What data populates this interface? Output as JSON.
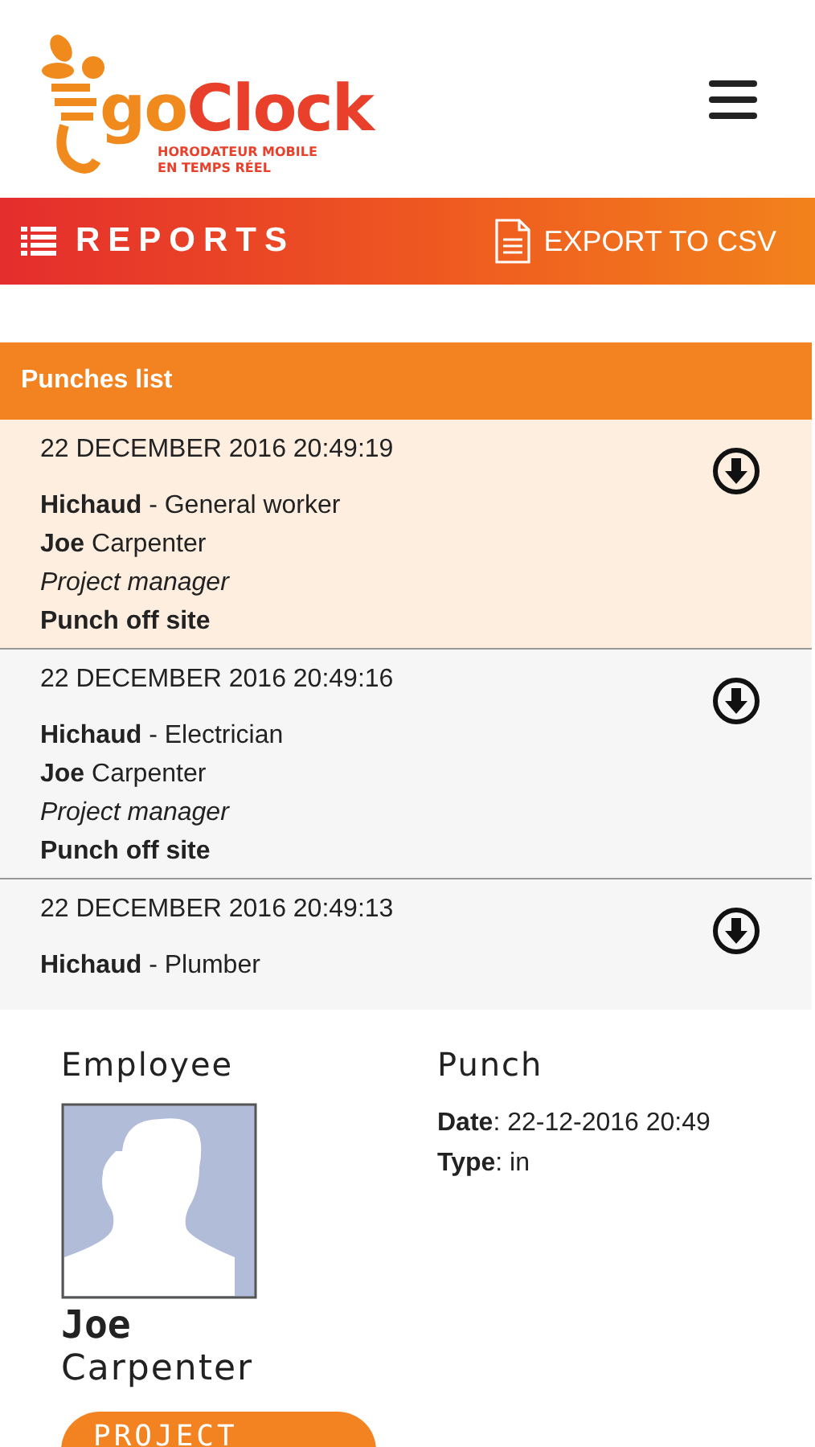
{
  "header": {
    "logo": {
      "prefix": "go",
      "name": "Clock",
      "tagline_1": "HORODATEUR MOBILE",
      "tagline_2": "EN TEMPS RÉEL"
    }
  },
  "toolbar": {
    "title": "REPORTS",
    "action": "EXPORT TO CSV"
  },
  "punches": {
    "title": "Punches list",
    "items": [
      {
        "timestamp": "22 DECEMBER 2016 20:49:19",
        "line_1": "**Hichaud** - General worker",
        "line_2": "**Joe** Carpenter",
        "role": "Project manager",
        "location": "Punch off site",
        "selected": true
      },
      {
        "timestamp": "22 DECEMBER 2016 20:49:16",
        "line_1": "**Hichaud** - Electrician",
        "line_2": "**Joe** Carpenter",
        "role": "Project manager",
        "location": "Punch off site",
        "selected": false
      },
      {
        "timestamp": "22 DECEMBER 2016 20:49:13",
        "line_1": "**Hichaud** - Plumber",
        "selected": false
      }
    ]
  },
  "detail": {
    "employee_heading": "Employee",
    "first_name": "Joe",
    "last_name": "Carpenter",
    "role_button": "PROJECT",
    "punch_heading": "Punch",
    "fields": [
      "**Date**: 22-12-2016 20:49",
      "**Type**: in"
    ]
  }
}
